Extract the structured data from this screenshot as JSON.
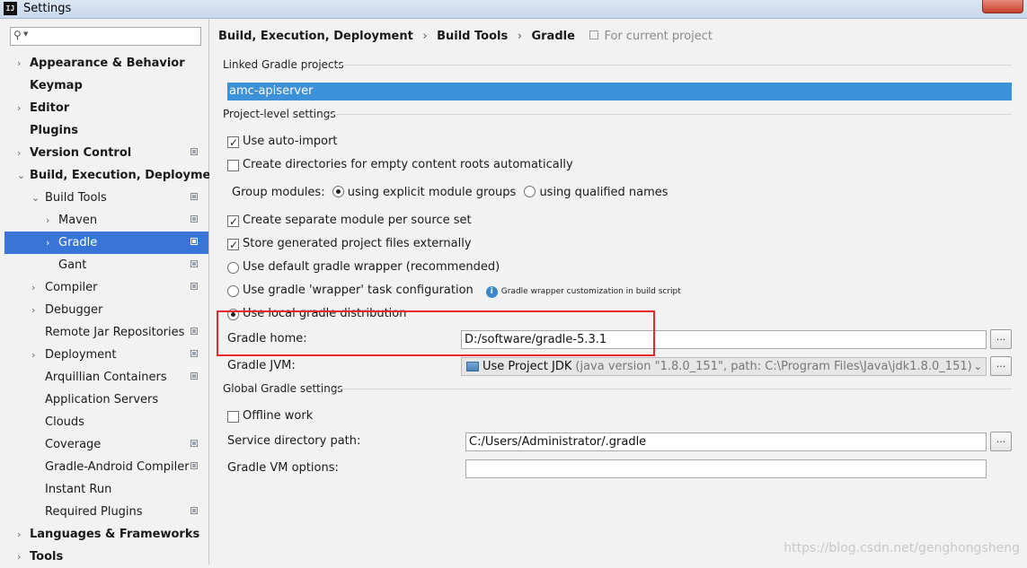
{
  "window": {
    "title": "Settings"
  },
  "sidebar": {
    "search": {
      "value": "",
      "placeholder": ""
    },
    "items": [
      {
        "label": "Appearance & Behavior",
        "bold": true,
        "arrow": "›",
        "indent": 0,
        "project": false,
        "selected": false
      },
      {
        "label": "Keymap",
        "bold": true,
        "arrow": "",
        "indent": 0,
        "project": false,
        "selected": false
      },
      {
        "label": "Editor",
        "bold": true,
        "arrow": "›",
        "indent": 0,
        "project": false,
        "selected": false
      },
      {
        "label": "Plugins",
        "bold": true,
        "arrow": "",
        "indent": 0,
        "project": false,
        "selected": false
      },
      {
        "label": "Version Control",
        "bold": true,
        "arrow": "›",
        "indent": 0,
        "project": true,
        "selected": false
      },
      {
        "label": "Build, Execution, Deployment",
        "bold": true,
        "arrow": "⌄",
        "indent": 0,
        "project": false,
        "selected": false
      },
      {
        "label": "Build Tools",
        "bold": false,
        "arrow": "⌄",
        "indent": 1,
        "project": true,
        "selected": false
      },
      {
        "label": "Maven",
        "bold": false,
        "arrow": "›",
        "indent": 2,
        "project": true,
        "selected": false
      },
      {
        "label": "Gradle",
        "bold": false,
        "arrow": "›",
        "indent": 2,
        "project": true,
        "selected": true
      },
      {
        "label": "Gant",
        "bold": false,
        "arrow": "",
        "indent": 2,
        "project": true,
        "selected": false
      },
      {
        "label": "Compiler",
        "bold": false,
        "arrow": "›",
        "indent": 1,
        "project": true,
        "selected": false
      },
      {
        "label": "Debugger",
        "bold": false,
        "arrow": "›",
        "indent": 1,
        "project": false,
        "selected": false
      },
      {
        "label": "Remote Jar Repositories",
        "bold": false,
        "arrow": "",
        "indent": 1,
        "project": true,
        "selected": false
      },
      {
        "label": "Deployment",
        "bold": false,
        "arrow": "›",
        "indent": 1,
        "project": true,
        "selected": false
      },
      {
        "label": "Arquillian Containers",
        "bold": false,
        "arrow": "",
        "indent": 1,
        "project": true,
        "selected": false
      },
      {
        "label": "Application Servers",
        "bold": false,
        "arrow": "",
        "indent": 1,
        "project": false,
        "selected": false
      },
      {
        "label": "Clouds",
        "bold": false,
        "arrow": "",
        "indent": 1,
        "project": false,
        "selected": false
      },
      {
        "label": "Coverage",
        "bold": false,
        "arrow": "",
        "indent": 1,
        "project": true,
        "selected": false
      },
      {
        "label": "Gradle-Android Compiler",
        "bold": false,
        "arrow": "",
        "indent": 1,
        "project": true,
        "selected": false
      },
      {
        "label": "Instant Run",
        "bold": false,
        "arrow": "",
        "indent": 1,
        "project": false,
        "selected": false
      },
      {
        "label": "Required Plugins",
        "bold": false,
        "arrow": "",
        "indent": 1,
        "project": true,
        "selected": false
      },
      {
        "label": "Languages & Frameworks",
        "bold": true,
        "arrow": "›",
        "indent": 0,
        "project": false,
        "selected": false
      },
      {
        "label": "Tools",
        "bold": true,
        "arrow": "›",
        "indent": 0,
        "project": false,
        "selected": false
      }
    ]
  },
  "breadcrumb": {
    "part1": "Build, Execution, Deployment",
    "part2": "Build Tools",
    "part3": "Gradle",
    "separator": "›",
    "scope": "For current project"
  },
  "linked": {
    "title": "Linked Gradle projects",
    "project": "amc-apiserver"
  },
  "project_settings": {
    "title": "Project-level settings",
    "auto_import": {
      "label": "Use auto-import",
      "checked": true
    },
    "create_dirs": {
      "label": "Create directories for empty content roots automatically",
      "checked": false
    },
    "group_modules": {
      "label": "Group modules:",
      "option1": "using explicit module groups",
      "option2": "using qualified names",
      "selected": 1
    },
    "separate_module": {
      "label": "Create separate module per source set",
      "checked": true
    },
    "store_external": {
      "label": "Store generated project files externally",
      "checked": true
    },
    "wrapper_default": {
      "label": "Use default gradle wrapper (recommended)",
      "checked": false
    },
    "wrapper_task": {
      "label": "Use gradle 'wrapper' task configuration",
      "checked": false
    },
    "wrapper_info": "Gradle wrapper customization in build script",
    "local_dist": {
      "label": "Use local gradle distribution",
      "checked": true
    },
    "gradle_home": {
      "label": "Gradle home:",
      "value": "D:/software/gradle-5.3.1"
    },
    "gradle_jvm": {
      "label": "Gradle JVM:",
      "name": "Use Project JDK",
      "detail": "(java version \"1.8.0_151\", path: C:\\Program Files\\Java\\jdk1.8.0_151)"
    }
  },
  "global_settings": {
    "title": "Global Gradle settings",
    "offline": {
      "label": "Offline work",
      "checked": false
    },
    "service_dir": {
      "label": "Service directory path:",
      "value": "C:/Users/Administrator/.gradle"
    },
    "vm_options": {
      "label": "Gradle VM options:",
      "value": ""
    }
  },
  "browse_label": "...",
  "watermark": "https://blog.csdn.net/genghongsheng"
}
